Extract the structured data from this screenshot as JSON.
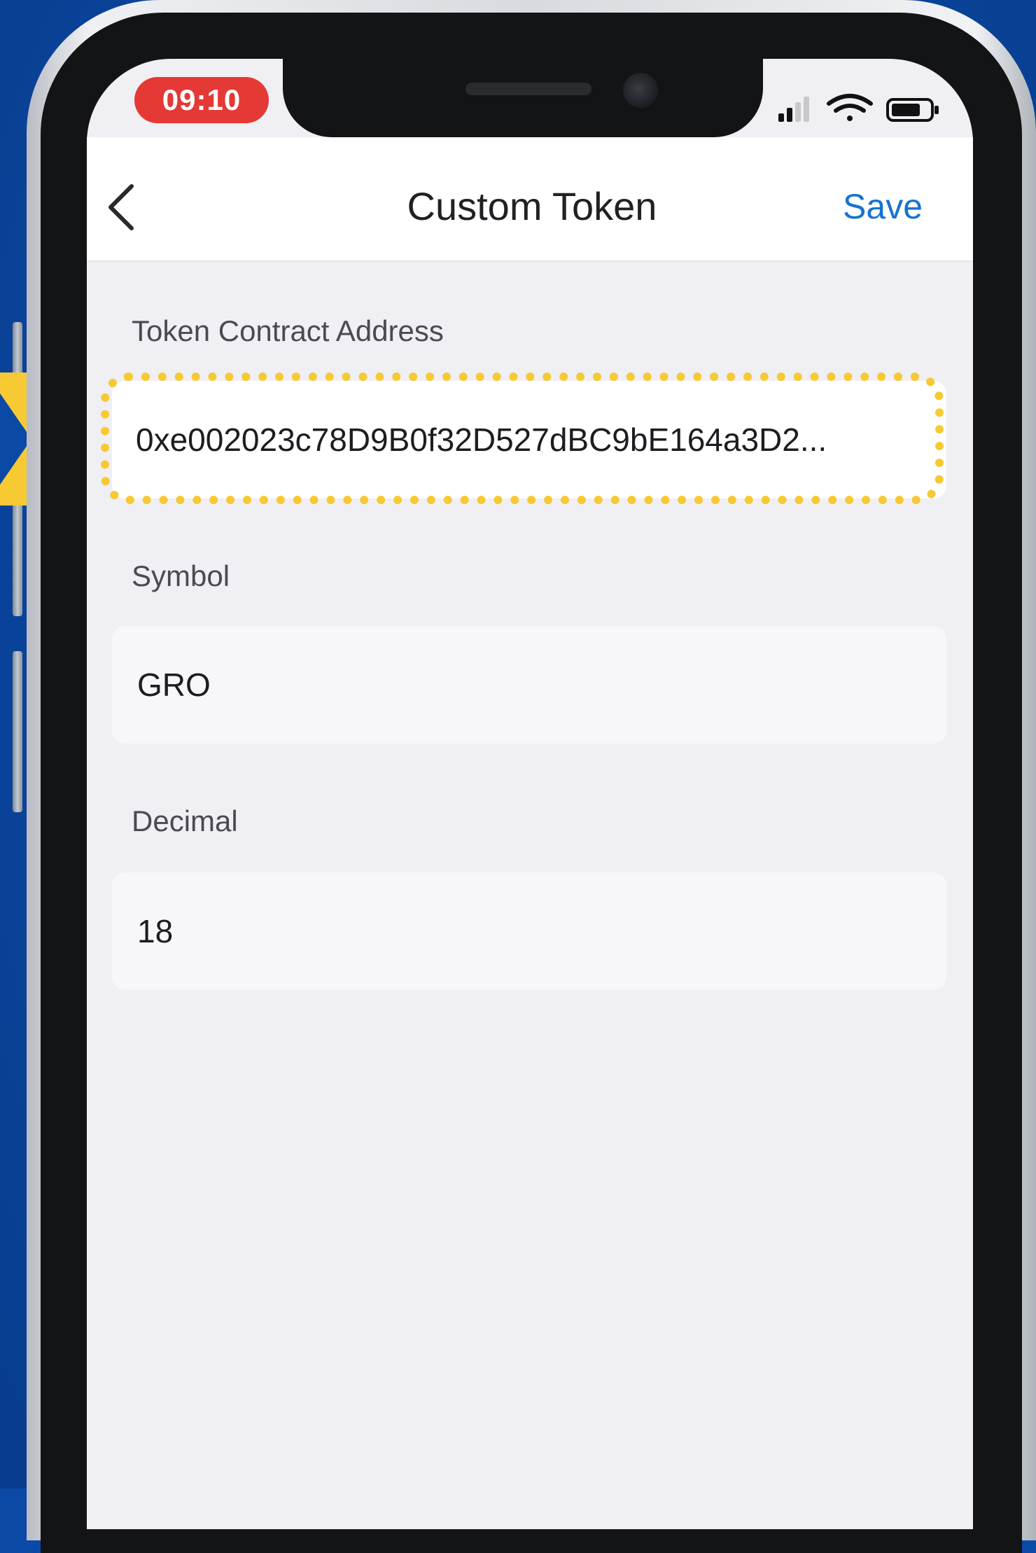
{
  "status_bar": {
    "time": "09:10"
  },
  "nav": {
    "title": "Custom Token",
    "save_label": "Save",
    "back_icon": "chevron-left-icon"
  },
  "form": {
    "contract_address": {
      "label": "Token Contract Address",
      "value": "0xe002023c78D9B0f32D527dBC9bE164a3D2..."
    },
    "symbol": {
      "label": "Symbol",
      "value": "GRO"
    },
    "decimal": {
      "label": "Decimal",
      "value": "18"
    }
  },
  "colors": {
    "background": "#0A4AA6",
    "accent": "#1573D0",
    "highlight": "#F7C932",
    "time_pill": "#E53935",
    "screen": "#EFEFF4"
  }
}
